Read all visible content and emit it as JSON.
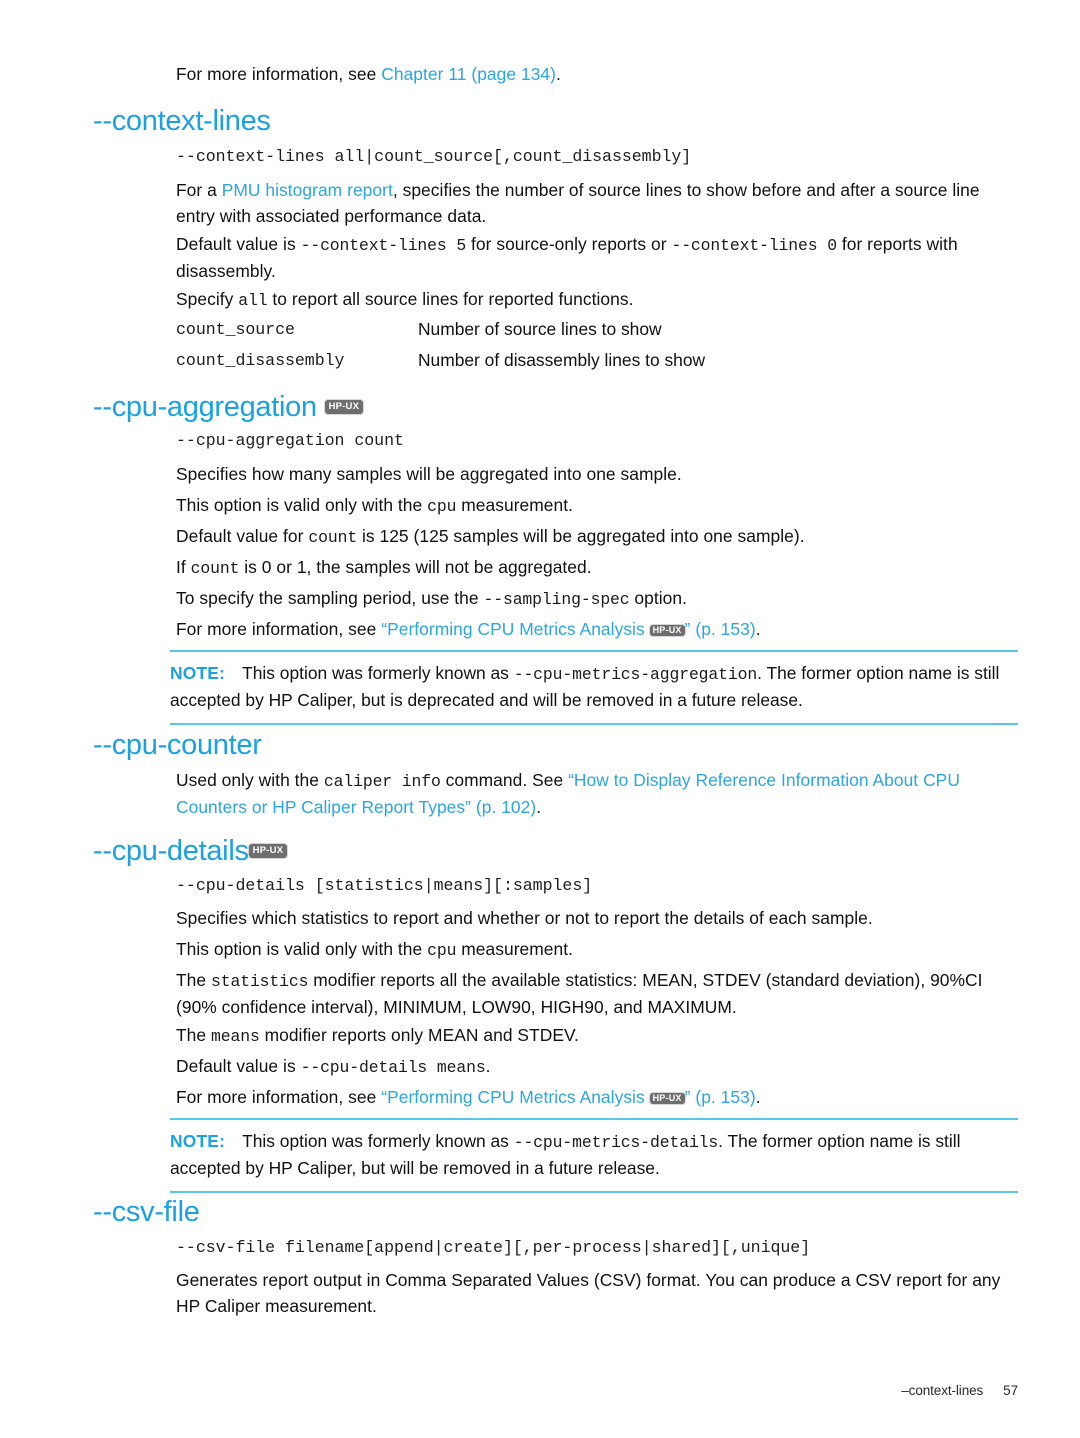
{
  "document": {
    "intro": {
      "prefix": "For more information, see ",
      "link": "Chapter 11 (page 134)",
      "suffix": "."
    },
    "footer": {
      "option": "–context-lines",
      "page_number": "57"
    },
    "badge_label": "HP-UX",
    "note_label": "NOTE:"
  },
  "sections": {
    "context_lines": {
      "heading": "--context-lines",
      "syntax": "--context-lines all|count_source[,count_disassembly]",
      "p1_a": "For a ",
      "p1_link": "PMU histogram report",
      "p1_b": ", specifies the number of source lines to show before and after a source line entry with associated performance data.",
      "p2_a": "Default value is ",
      "p2_code1": "--context-lines 5",
      "p2_b": " for source-only reports or ",
      "p2_code2": "--context-lines 0",
      "p2_c": " for reports with disassembly.",
      "p3_a": "Specify ",
      "p3_code": "all",
      "p3_b": " to report all source lines for reported functions.",
      "definitions": [
        {
          "term": "count_source",
          "desc": "Number of source lines to show"
        },
        {
          "term": "count_disassembly",
          "desc": "Number of disassembly lines to show"
        }
      ]
    },
    "cpu_aggregation": {
      "heading": "--cpu-aggregation",
      "has_badge": true,
      "syntax": "--cpu-aggregation count",
      "p1": "Specifies how many samples will be aggregated into one sample.",
      "p2_a": "This option is valid only with the ",
      "p2_code": "cpu",
      "p2_b": " measurement.",
      "p3_a": "Default value for ",
      "p3_code": "count",
      "p3_b": " is 125 (125 samples will be aggregated into one sample).",
      "p4_a": "If ",
      "p4_code": "count",
      "p4_b": " is 0 or 1, the samples will not be aggregated.",
      "p5_a": "To specify the sampling period, use the ",
      "p5_code": "--sampling-spec",
      "p5_b": " option.",
      "p6_a": "For more information, see ",
      "p6_link_open": "“Performing CPU Metrics Analysis ",
      "p6_link_close": "” (p. 153)",
      "p6_b": ".",
      "note_a": "This option was formerly known as ",
      "note_code": "--cpu-metrics-aggregation",
      "note_b": ". The former option name is still accepted by HP Caliper, but is deprecated and will be removed in a future release."
    },
    "cpu_counter": {
      "heading": "--cpu-counter",
      "p1_a": "Used only with the ",
      "p1_code": "caliper info",
      "p1_b": " command. See ",
      "p1_link": "“How to Display Reference Information About CPU Counters or HP Caliper Report Types” (p. 102)",
      "p1_c": "."
    },
    "cpu_details": {
      "heading": "--cpu-details",
      "has_badge": true,
      "syntax": "--cpu-details [statistics|means][:samples]",
      "p1": "Specifies which statistics to report and whether or not to report the details of each sample.",
      "p2_a": "This option is valid only with the ",
      "p2_code": "cpu",
      "p2_b": " measurement.",
      "p3_a": "The ",
      "p3_code": "statistics",
      "p3_b": " modifier reports all the available statistics: MEAN, STDEV (standard deviation), 90%CI (90% confidence interval), MINIMUM, LOW90, HIGH90, and MAXIMUM.",
      "p4_a": "The ",
      "p4_code": "means",
      "p4_b": " modifier reports only MEAN and STDEV.",
      "p5_a": "Default value is ",
      "p5_code": "--cpu-details means",
      "p5_b": ".",
      "p6_a": "For more information, see ",
      "p6_link_open": "“Performing CPU Metrics Analysis ",
      "p6_link_close": "” (p. 153)",
      "p6_b": ".",
      "note_a": "This option was formerly known as ",
      "note_code": "--cpu-metrics-details",
      "note_b": ". The former option name is still accepted by HP Caliper, but will be removed in a future release."
    },
    "csv_file": {
      "heading": "--csv-file",
      "syntax": "--csv-file filename[append|create][,per-process|shared][,unique]",
      "p1": "Generates report output in Comma Separated Values (CSV) format. You can produce a CSV report for any HP Caliper measurement."
    }
  },
  "colors": {
    "heading": "#1BA1E2",
    "link": "#2BA6DE",
    "rule": "#59C6EA",
    "badge_bg": "#6E6E6E",
    "text": "#111111"
  }
}
